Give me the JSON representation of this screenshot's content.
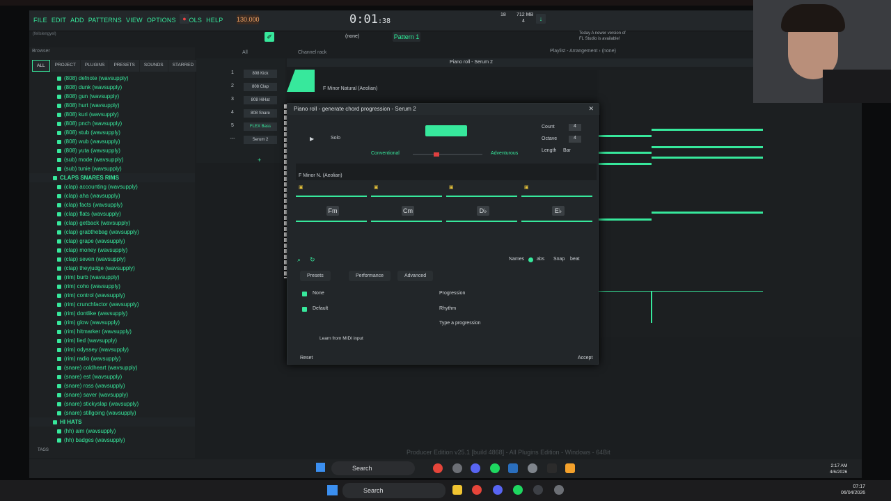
{
  "menu": [
    "FILE",
    "EDIT",
    "ADD",
    "PATTERNS",
    "VIEW",
    "OPTIONS",
    "TOOLS",
    "HELP"
  ],
  "hint": "(fellslengyel)",
  "transport": {
    "bpm": "130.000",
    "time_main": "0:01",
    "time_sub": ":38",
    "meter": "18",
    "memory": "712 MB",
    "cpu_label": "4"
  },
  "pattern": {
    "label": "Pattern 1",
    "none_label": "(none)"
  },
  "news": {
    "line1": "Today  A newer version of",
    "line2": "FL Studio is available!"
  },
  "browser": {
    "title": "Browser",
    "tabs": [
      "ALL",
      "PROJECT",
      "PLUGINS",
      "PRESETS",
      "SOUNDS",
      "STARRED"
    ],
    "items": [
      {
        "t": "(808) defnote (wavsupply)",
        "f": false
      },
      {
        "t": "(808) dunk (wavsupply)",
        "f": false
      },
      {
        "t": "(808) gun (wavsupply)",
        "f": false
      },
      {
        "t": "(808) hurt (wavsupply)",
        "f": false
      },
      {
        "t": "(808) kuri (wavsupply)",
        "f": false
      },
      {
        "t": "(808) pnch (wavsupply)",
        "f": false
      },
      {
        "t": "(808) stub (wavsupply)",
        "f": false
      },
      {
        "t": "(808) wub (wavsupply)",
        "f": false
      },
      {
        "t": "(808) yuta (wavsupply)",
        "f": false
      },
      {
        "t": "(sub) mode (wavsupply)",
        "f": false
      },
      {
        "t": "(sub) tunie (wavsupply)",
        "f": false
      },
      {
        "t": "CLAPS SNARES RIMS",
        "f": true
      },
      {
        "t": "(clap) accounting (wavsupply)",
        "f": false
      },
      {
        "t": "(clap) aha (wavsupply)",
        "f": false
      },
      {
        "t": "(clap) facts (wavsupply)",
        "f": false
      },
      {
        "t": "(clap) flats (wavsupply)",
        "f": false
      },
      {
        "t": "(clap) getback (wavsupply)",
        "f": false
      },
      {
        "t": "(clap) grabthebag (wavsupply)",
        "f": false
      },
      {
        "t": "(clap) grape (wavsupply)",
        "f": false
      },
      {
        "t": "(clap) money (wavsupply)",
        "f": false
      },
      {
        "t": "(clap) seven (wavsupply)",
        "f": false
      },
      {
        "t": "(clap) theyjudge (wavsupply)",
        "f": false
      },
      {
        "t": "(rim) burb (wavsupply)",
        "f": false
      },
      {
        "t": "(rim) coho (wavsupply)",
        "f": false
      },
      {
        "t": "(rim) control (wavsupply)",
        "f": false
      },
      {
        "t": "(rim) crunchfactor (wavsupply)",
        "f": false
      },
      {
        "t": "(rim) dontlike (wavsupply)",
        "f": false
      },
      {
        "t": "(rim) glow (wavsupply)",
        "f": false
      },
      {
        "t": "(rim) hitmarker (wavsupply)",
        "f": false
      },
      {
        "t": "(rim) lied (wavsupply)",
        "f": false
      },
      {
        "t": "(rim) odyssey (wavsupply)",
        "f": false
      },
      {
        "t": "(rim) radio (wavsupply)",
        "f": false
      },
      {
        "t": "(snare) coldheart (wavsupply)",
        "f": false
      },
      {
        "t": "(snare) est (wavsupply)",
        "f": false
      },
      {
        "t": "(snare) ross (wavsupply)",
        "f": false
      },
      {
        "t": "(snare) saver (wavsupply)",
        "f": false
      },
      {
        "t": "(snare) stickyslap (wavsupply)",
        "f": false
      },
      {
        "t": "(snare) stillgoing (wavsupply)",
        "f": false
      },
      {
        "t": "HI HATS",
        "f": true
      },
      {
        "t": "(hh) aim (wavsupply)",
        "f": false
      },
      {
        "t": "(hh) badges (wavsupply)",
        "f": false
      }
    ],
    "tags_label": "TAGS"
  },
  "channel_rack": {
    "title": "Channel rack",
    "filter": "All",
    "channels": [
      {
        "num": "1",
        "name": "808 Kick"
      },
      {
        "num": "2",
        "name": "808 Clap"
      },
      {
        "num": "3",
        "name": "808 HiHat"
      },
      {
        "num": "4",
        "name": "808 Snare"
      },
      {
        "num": "5",
        "name": "FLEX Bass"
      },
      {
        "num": "---",
        "name": "Serum 2"
      }
    ]
  },
  "piano_roll": {
    "title": "Piano roll - Serum 2",
    "scale": "F Minor Natural (Aeolian)"
  },
  "playlist": {
    "title": "Playlist - Arrangement › (none)"
  },
  "dialog": {
    "title": "Piano roll - generate chord progression - Serum 2",
    "solo": "Solo",
    "conventional": "Conventional",
    "adventurous": "Adventurous",
    "count_label": "Count",
    "count_value": "4",
    "octave_label": "Octave",
    "octave_value": "4",
    "length_label": "Length",
    "length_value": "Bar",
    "scale": "F Minor N. (Aeolian)",
    "chords": [
      "Fm",
      "Cm",
      "D♭",
      "E♭"
    ],
    "names_label": "Names",
    "abs_label": "abs",
    "snap_label": "Snap",
    "snap_value": "beat",
    "tabs": [
      "Presets",
      "Performance",
      "Advanced"
    ],
    "preset1": "None",
    "preset2": "Default",
    "progression": "Progression",
    "rhythm": "Rhythm",
    "type_progression": "Type a progression",
    "learn": "Learn from MIDI input",
    "reset": "Reset",
    "accept": "Accept"
  },
  "watermark": "Producer Edition v25.1 [build 4868] - All Plugins Edition - Windows - 64Bit",
  "taskbar_inner": {
    "search": "Search",
    "time": "2:17 AM",
    "date": "4/6/2026"
  },
  "taskbar_outer": {
    "search": "Search",
    "time": "07:17",
    "date": "06/04/2026"
  },
  "colors": {
    "accent": "#37e89c",
    "bg": "#1b1e20",
    "panel": "#222629"
  }
}
